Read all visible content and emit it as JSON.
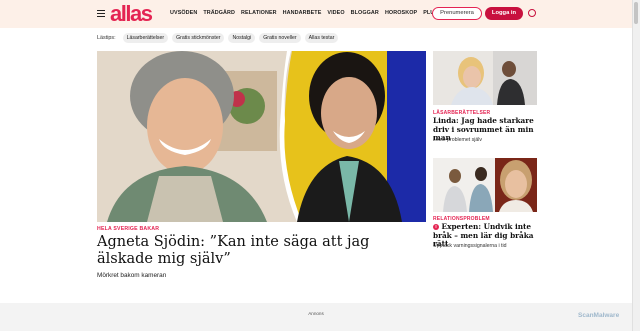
{
  "header": {
    "logo": "allas",
    "nav": [
      "UVSÖDEN",
      "TRÄDGÅRD",
      "RELATIONER",
      "HANDARBETE",
      "VIDEO",
      "BLOGGAR",
      "HOROSKOP",
      "PLUS"
    ],
    "subscribe_label": "Prenumerera",
    "login_label": "Logga in"
  },
  "tips": {
    "label": "Lästips:",
    "chips": [
      "Läsarberättelser",
      "Gratis stickmönster",
      "Nostalgi",
      "Gratis noveller",
      "Allas testar"
    ]
  },
  "hero": {
    "kicker": "HELA SVERIGE BAKAR",
    "title": "Agneta Sjödin: ”Kan inte säga att jag älskade mig själv”",
    "subtitle": "Mörkret bakom kameran"
  },
  "side": [
    {
      "kicker": "LÄSARBERÄTTELSER",
      "title": "Linda: Jag hade starkare driv i sovrummet än min man",
      "subtitle": "Löste problemet själv"
    },
    {
      "kicker": "RELATIONSPROBLEM",
      "title": "Experten: Undvik inte bråk – men lär dig bråka rätt",
      "subtitle": "Upptäck varningssignalerna i tid"
    }
  ],
  "ad": {
    "label": "Annons"
  },
  "watermark": "ScanMalware",
  "colors": {
    "brand": "#e42452",
    "header_bg": "#fdf0e8",
    "login_bg": "#c8103e"
  },
  "icons": [
    "menu-icon",
    "user-icon",
    "alert-icon"
  ]
}
